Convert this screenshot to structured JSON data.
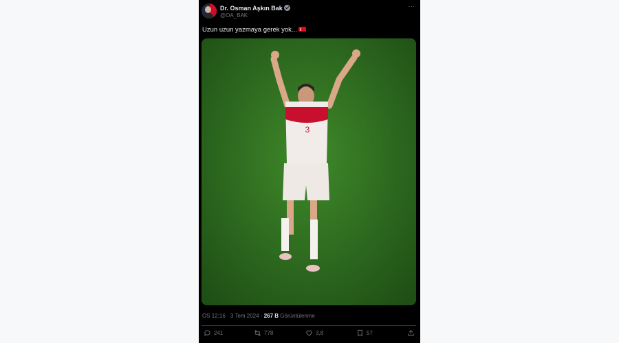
{
  "post": {
    "author_name": "Dr. Osman Aşkın Bak",
    "author_handle": "@OA_BAK",
    "more_icon": "more-icon",
    "text": "Uzun uzun yazmaya gerek yok...",
    "flag_emoji": "turkey-flag",
    "time": "ÖS 12:16 · 3 Tem 2024 · ",
    "views_count": "267 B",
    "views_label": " Görüntülenme"
  },
  "actions": {
    "replies": "241",
    "reposts": "778",
    "likes": "3,8",
    "bookmarks": "57"
  },
  "colors": {
    "background": "#000000",
    "pitch": "#2f6b1f",
    "kit_red": "#c8102e"
  }
}
